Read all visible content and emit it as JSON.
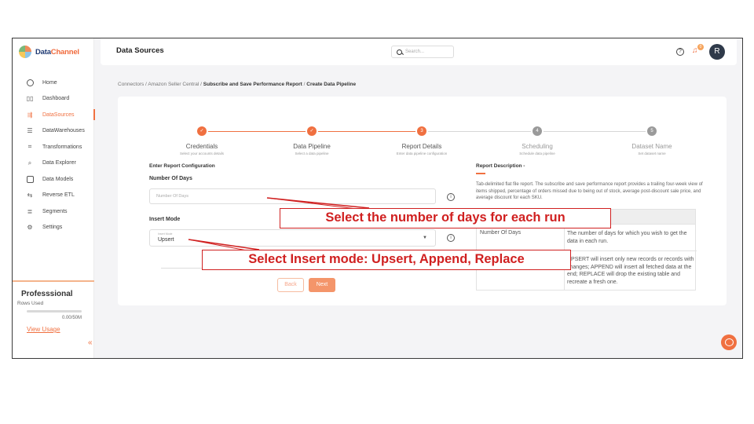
{
  "app": {
    "logo_text_part1": "Data",
    "logo_text_part2": "Channel",
    "page_title": "Data Sources",
    "search_placeholder": "Search...",
    "notification_count": "0",
    "avatar_initial": "R"
  },
  "sidebar": {
    "items": [
      {
        "label": "Home",
        "icon": "home-icon"
      },
      {
        "label": "Dashboard",
        "icon": "dashboard-icon"
      },
      {
        "label": "DataSources",
        "icon": "datasources-icon",
        "active": true
      },
      {
        "label": "DataWarehouses",
        "icon": "database-icon"
      },
      {
        "label": "Transformations",
        "icon": "transform-icon"
      },
      {
        "label": "Data Explorer",
        "icon": "explorer-icon"
      },
      {
        "label": "Data Models",
        "icon": "models-icon"
      },
      {
        "label": "Reverse ETL",
        "icon": "reverse-etl-icon"
      },
      {
        "label": "Segments",
        "icon": "segments-icon"
      },
      {
        "label": "Settings",
        "icon": "settings-icon"
      }
    ],
    "plan": {
      "title": "Professsional",
      "rows_label": "Rows Used",
      "rows_count": "0.00/50M",
      "rows_used_fraction": 0,
      "view_usage": "View Usage"
    }
  },
  "breadcrumb": {
    "part1": "Connectors",
    "part2": "Amazon Seller Central",
    "part3": "Subscribe and Save Performance Report",
    "part4": "Create Data Pipeline",
    "separator": " / "
  },
  "stepper": {
    "steps": [
      {
        "label": "Credentials",
        "sub": "Select your accounts details",
        "state": "done",
        "marker": "✓"
      },
      {
        "label": "Data Pipeline",
        "sub": "Select a data pipeline",
        "state": "done",
        "marker": "✓"
      },
      {
        "label": "Report Details",
        "sub": "Enter data pipeline configuration",
        "state": "current",
        "marker": "3"
      },
      {
        "label": "Scheduling",
        "sub": "Schedule data pipeline",
        "state": "todo",
        "marker": "4"
      },
      {
        "label": "Dataset Name",
        "sub": "Set dataset name",
        "state": "todo",
        "marker": "5"
      }
    ],
    "colors": {
      "done": "#f07040",
      "current": "#f07040",
      "todo": "#9a9a9a"
    }
  },
  "form": {
    "heading": "Enter Report Configuration",
    "days_label": "Number Of Days",
    "days_placeholder": "Number Of Days",
    "insert_label": "Insert Mode",
    "insert_mini_label": "Insert Mode",
    "insert_value": "Upsert",
    "back_button": "Back",
    "next_button": "Next"
  },
  "description": {
    "title": "Report Description -",
    "text": "Tab-delimited flat file report. The subscribe and save performance report provides a trailing four-week view of items shipped, percentage of orders missed due to being out of stock, average post-discount sale price, and average discount for each SKU.",
    "params": [
      {
        "name": "Number Of Days",
        "desc": "The number of days for which you wish to get the data in each run."
      },
      {
        "name": "",
        "desc": "UPSERT will insert only new records or records with changes; APPEND will insert all fetched data at the end; REPLACE will drop the existing table and recreate a fresh one."
      }
    ]
  },
  "callouts": {
    "days": "Select the number of days for each run",
    "insert": "Select Insert mode: Upsert, Append, Replace"
  }
}
